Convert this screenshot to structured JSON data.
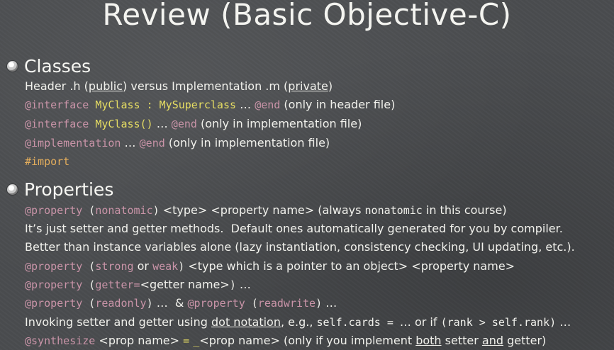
{
  "slide": {
    "title": "Review (Basic Objective-C)"
  },
  "sections": [
    {
      "label": "Classes",
      "icon": "bullet-icon",
      "lines": [
        [
          {
            "t": "Header .h (",
            "s": "plain"
          },
          {
            "t": "public",
            "s": "plain u"
          },
          {
            "t": ") versus Implementation .m (",
            "s": "plain"
          },
          {
            "t": "private",
            "s": "plain u"
          },
          {
            "t": ")",
            "s": "plain"
          }
        ],
        [
          {
            "t": "@interface",
            "s": "code kw"
          },
          {
            "t": " ",
            "s": "code plain"
          },
          {
            "t": "MyClass : MySuperclass",
            "s": "code cls"
          },
          {
            "t": " … ",
            "s": "plain"
          },
          {
            "t": "@end",
            "s": "code kw"
          },
          {
            "t": " (only in header file)",
            "s": "plain"
          }
        ],
        [
          {
            "t": "@interface",
            "s": "code kw"
          },
          {
            "t": " ",
            "s": "code plain"
          },
          {
            "t": "MyClass()",
            "s": "code cls"
          },
          {
            "t": " … ",
            "s": "plain"
          },
          {
            "t": "@end",
            "s": "code kw"
          },
          {
            "t": " (only in implementation file)",
            "s": "plain"
          }
        ],
        [
          {
            "t": "@implementation",
            "s": "code kw"
          },
          {
            "t": " … ",
            "s": "plain"
          },
          {
            "t": "@end",
            "s": "code kw"
          },
          {
            "t": " (only in implementation file)",
            "s": "plain"
          }
        ],
        [
          {
            "t": "#import",
            "s": "code dir"
          }
        ]
      ]
    },
    {
      "label": "Properties",
      "icon": "bullet-icon",
      "lines": [
        [
          {
            "t": "@property",
            "s": "code kw"
          },
          {
            "t": " (",
            "s": "code plain"
          },
          {
            "t": "nonatomic",
            "s": "code kw"
          },
          {
            "t": ")",
            "s": "code plain"
          },
          {
            "t": " <type> <property name> (always ",
            "s": "plain"
          },
          {
            "t": "nonatomic",
            "s": "code plain"
          },
          {
            "t": " in this course)",
            "s": "plain"
          }
        ],
        [
          {
            "t": "It’s just setter and getter methods.  Default ones automatically generated for you by compiler.",
            "s": "plain"
          }
        ],
        [
          {
            "t": "Better than instance variables alone (lazy instantiation, consistency checking, UI updating, etc.).",
            "s": "plain"
          }
        ],
        [
          {
            "t": "@property",
            "s": "code kw"
          },
          {
            "t": " (",
            "s": "code plain"
          },
          {
            "t": "strong",
            "s": "code kw"
          },
          {
            "t": " or ",
            "s": "plain"
          },
          {
            "t": "weak",
            "s": "code kw"
          },
          {
            "t": ")",
            "s": "code plain"
          },
          {
            "t": " <type which is a pointer to an object> <property name>",
            "s": "plain"
          }
        ],
        [
          {
            "t": "@property",
            "s": "code kw"
          },
          {
            "t": " (",
            "s": "code plain"
          },
          {
            "t": "getter=",
            "s": "code kw"
          },
          {
            "t": "<getter name>",
            "s": "plain"
          },
          {
            "t": ")",
            "s": "code plain"
          },
          {
            "t": " …",
            "s": "plain"
          }
        ],
        [
          {
            "t": "@property",
            "s": "code kw"
          },
          {
            "t": " (",
            "s": "code plain"
          },
          {
            "t": "readonly",
            "s": "code kw"
          },
          {
            "t": ")",
            "s": "code plain"
          },
          {
            "t": " …  & ",
            "s": "plain"
          },
          {
            "t": "@property",
            "s": "code kw"
          },
          {
            "t": " (",
            "s": "code plain"
          },
          {
            "t": "readwrite",
            "s": "code kw"
          },
          {
            "t": ")",
            "s": "code plain"
          },
          {
            "t": " …",
            "s": "plain"
          }
        ],
        [
          {
            "t": "Invoking setter and getter using ",
            "s": "plain"
          },
          {
            "t": "dot notation",
            "s": "plain u"
          },
          {
            "t": ", e.g., ",
            "s": "plain"
          },
          {
            "t": "self.cards = ",
            "s": "code plain"
          },
          {
            "t": "… or if ",
            "s": "plain"
          },
          {
            "t": "(rank > self.rank)",
            "s": "code plain"
          },
          {
            "t": " …",
            "s": "plain"
          }
        ],
        [
          {
            "t": "@synthesize",
            "s": "code kw"
          },
          {
            "t": " <prop name> ",
            "s": "plain"
          },
          {
            "t": "=",
            "s": "code cls"
          },
          {
            "t": " ",
            "s": "plain"
          },
          {
            "t": "_",
            "s": "code cls"
          },
          {
            "t": "<prop name> (only if you implement ",
            "s": "plain"
          },
          {
            "t": "both",
            "s": "plain u"
          },
          {
            "t": " setter ",
            "s": "plain"
          },
          {
            "t": "and",
            "s": "plain u"
          },
          {
            "t": " getter)",
            "s": "plain"
          }
        ]
      ]
    }
  ],
  "colors": {
    "background": "#4a4c4f",
    "text": "#f1f1ec",
    "keyword": "#c994a8",
    "class_name": "#e6dd63",
    "directive": "#e3ad5c"
  }
}
